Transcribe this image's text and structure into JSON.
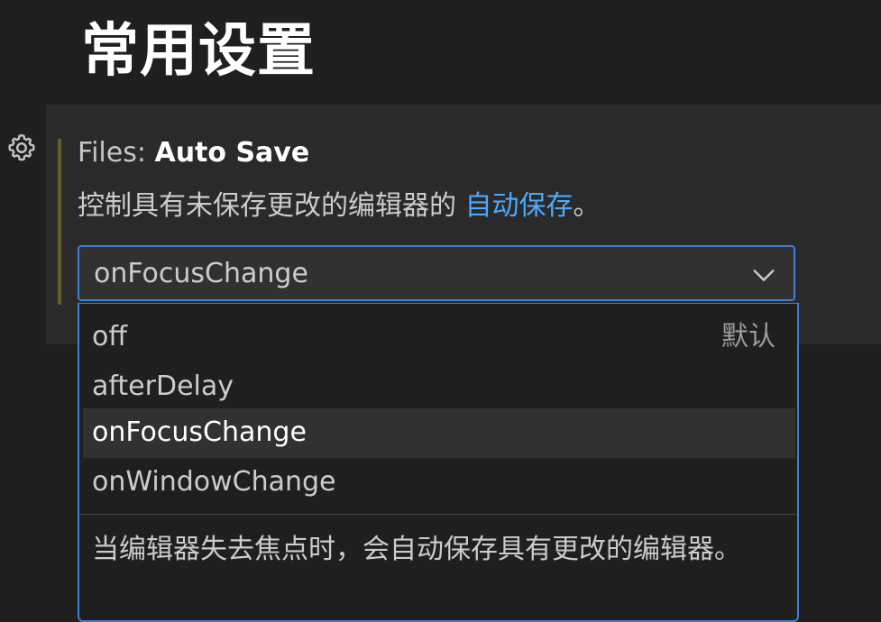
{
  "section": {
    "title": "常用设置"
  },
  "setting": {
    "category": "Files: ",
    "name": "Auto Save",
    "description_prefix": "控制具有未保存更改的编辑器的 ",
    "description_link": "自动保存",
    "description_suffix": "。",
    "icon": "gear-icon",
    "modified_indicator_color": "#6b5a30",
    "link_color": "#4daafc"
  },
  "select": {
    "value": "onFocusChange",
    "icon": "chevron-down-icon",
    "accent_color": "#3e7fd6",
    "options": [
      {
        "label": "off",
        "hint": "默认",
        "selected": false
      },
      {
        "label": "afterDelay",
        "hint": "",
        "selected": false
      },
      {
        "label": "onFocusChange",
        "hint": "",
        "selected": true
      },
      {
        "label": "onWindowChange",
        "hint": "",
        "selected": false
      }
    ],
    "selected_description": "当编辑器失去焦点时，会自动保存具有更改的编辑器。"
  }
}
